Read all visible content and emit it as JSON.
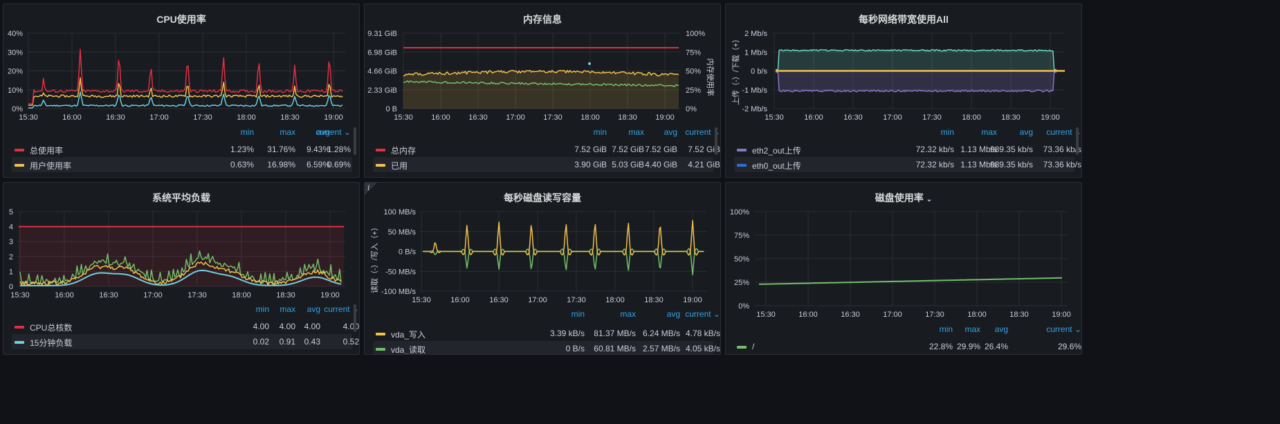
{
  "colors": {
    "red": "#e02f44",
    "yellow": "#f2c04b",
    "cyan": "#6ed0e0",
    "green": "#73bf69",
    "purple": "#8a76c8",
    "blue": "#2f6fd0",
    "teal": "#6bd5c2",
    "accent": "#33a2e5"
  },
  "legend_headers": {
    "min": "min",
    "max": "max",
    "avg": "avg",
    "current": "current"
  },
  "time_ticks": [
    "15:30",
    "16:00",
    "16:30",
    "17:00",
    "17:30",
    "18:00",
    "18:30",
    "19:00"
  ],
  "panels": {
    "cpu": {
      "title": "CPU使用率",
      "y_ticks": [
        "40%",
        "30%",
        "20%",
        "10%",
        "0%"
      ],
      "legend": [
        {
          "name": "总使用率",
          "color": "red",
          "min": "1.23%",
          "max": "31.76%",
          "avg": "9.43%",
          "current": "1.28%"
        },
        {
          "name": "用户使用率",
          "color": "yellow",
          "min": "0.63%",
          "max": "16.98%",
          "avg": "6.59%",
          "current": "0.69%"
        }
      ]
    },
    "memory": {
      "title": "内存信息",
      "y_ticks_left": [
        "9.31 GiB",
        "6.98 GiB",
        "4.66 GiB",
        "2.33 GiB",
        "0 B"
      ],
      "y_ticks_right": [
        "100%",
        "75%",
        "50%",
        "25%",
        "0%"
      ],
      "y_label_right": "内存使用率",
      "legend": [
        {
          "name": "总内存",
          "color": "red",
          "min": "7.52 GiB",
          "max": "7.52 GiB",
          "avg": "7.52 GiB",
          "current": "7.52 GiB"
        },
        {
          "name": "已用",
          "color": "yellow",
          "min": "3.90 GiB",
          "max": "5.03 GiB",
          "avg": "4.40 GiB",
          "current": "4.21 GiB"
        }
      ]
    },
    "network": {
      "title": "每秒网络带宽使用All",
      "y_ticks": [
        "2 Mb/s",
        "1 Mb/s",
        "0 b/s",
        "-1 Mb/s",
        "-2 Mb/s"
      ],
      "y_label": "上传（-）/下载（+）",
      "legend": [
        {
          "name": "eth2_out上传",
          "color": "purple",
          "min": "72.32 kb/s",
          "max": "1.13 Mb/s",
          "avg": "989.35 kb/s",
          "current": "73.36 kb/s"
        },
        {
          "name": "eth0_out上传",
          "color": "blue",
          "min": "72.32 kb/s",
          "max": "1.13 Mb/s",
          "avg": "989.35 kb/s",
          "current": "73.36 kb/s"
        }
      ]
    },
    "load": {
      "title": "系统平均负载",
      "y_ticks": [
        "5",
        "4",
        "3",
        "2",
        "1",
        "0"
      ],
      "legend": [
        {
          "name": "CPU总核数",
          "color": "red",
          "min": "4.00",
          "max": "4.00",
          "avg": "4.00",
          "current": "4.00"
        },
        {
          "name": "15分钟负载",
          "color": "cyan",
          "min": "0.02",
          "max": "0.91",
          "avg": "0.43",
          "current": "0.52"
        }
      ]
    },
    "disk_io": {
      "title": "每秒磁盘读写容量",
      "y_ticks": [
        "100 MB/s",
        "50 MB/s",
        "0 B/s",
        "-50 MB/s",
        "-100 MB/s"
      ],
      "y_label": "读取（-）/写入（+）",
      "legend": [
        {
          "name": "vda_写入",
          "color": "yellow",
          "min": "3.39 kB/s",
          "max": "81.37 MB/s",
          "avg": "6.24 MB/s",
          "current": "4.78 kB/s"
        },
        {
          "name": "vda_读取",
          "color": "green",
          "min": "0 B/s",
          "max": "60.81 MB/s",
          "avg": "2.57 MB/s",
          "current": "4.05 kB/s"
        }
      ]
    },
    "disk_usage": {
      "title": "磁盘使用率",
      "y_ticks": [
        "100%",
        "75%",
        "50%",
        "25%",
        "0%"
      ],
      "legend": [
        {
          "name": "/",
          "color": "green",
          "min": "22.8%",
          "max": "29.9%",
          "avg": "26.4%",
          "current": "29.6%"
        }
      ]
    }
  },
  "chart_data": [
    {
      "type": "line",
      "title": "CPU使用率",
      "ylim": [
        0,
        40
      ],
      "x": [
        "15:30",
        "16:00",
        "16:30",
        "17:00",
        "17:30",
        "18:00",
        "18:30",
        "19:00"
      ],
      "series": [
        {
          "name": "总使用率",
          "values": [
            8.5,
            31,
            30,
            24,
            28,
            28,
            27,
            23,
            29
          ]
        },
        {
          "name": "用户使用率",
          "values": [
            6,
            16,
            15,
            13,
            14,
            14,
            14,
            12,
            15
          ]
        }
      ]
    },
    {
      "type": "line",
      "title": "内存信息",
      "ylim": [
        "0 B",
        "9.31 GiB"
      ],
      "series": [
        {
          "name": "总内存",
          "values": [
            7.52,
            7.52
          ]
        },
        {
          "name": "已用",
          "values": [
            4.0,
            4.21
          ]
        }
      ]
    },
    {
      "type": "area",
      "title": "每秒网络带宽使用All",
      "ylim": [
        "-2 Mb/s",
        "2 Mb/s"
      ],
      "series": [
        {
          "name": "eth2_out上传",
          "values": [
            0.07,
            1.13,
            1.13,
            0.07
          ]
        },
        {
          "name": "eth0_out上传",
          "values": [
            0.07,
            1.13,
            1.13,
            0.07
          ]
        }
      ]
    },
    {
      "type": "line",
      "title": "系统平均负载",
      "ylim": [
        0,
        5
      ],
      "series": [
        {
          "name": "CPU总核数",
          "values": [
            4,
            4
          ]
        },
        {
          "name": "15分钟负载",
          "values": [
            0.02,
            0.3,
            0.8,
            0.91,
            0.5,
            0.3,
            0.4,
            0.9,
            0.6,
            0.3,
            0.52
          ]
        }
      ]
    },
    {
      "type": "line",
      "title": "每秒磁盘读写容量",
      "ylim": [
        -100,
        100
      ],
      "series": [
        {
          "name": "vda_写入",
          "values": [
            0,
            27,
            70,
            81,
            75,
            76,
            78,
            77,
            78,
            79
          ]
        },
        {
          "name": "vda_读取",
          "values": [
            0,
            -10,
            -45,
            -48,
            -50,
            -52,
            -51,
            -52,
            -53,
            -60
          ]
        }
      ]
    },
    {
      "type": "line",
      "title": "磁盘使用率",
      "ylim": [
        0,
        100
      ],
      "series": [
        {
          "name": "/",
          "values": [
            22.8,
            24,
            25,
            26,
            27,
            28,
            29,
            29.6
          ]
        }
      ]
    }
  ]
}
